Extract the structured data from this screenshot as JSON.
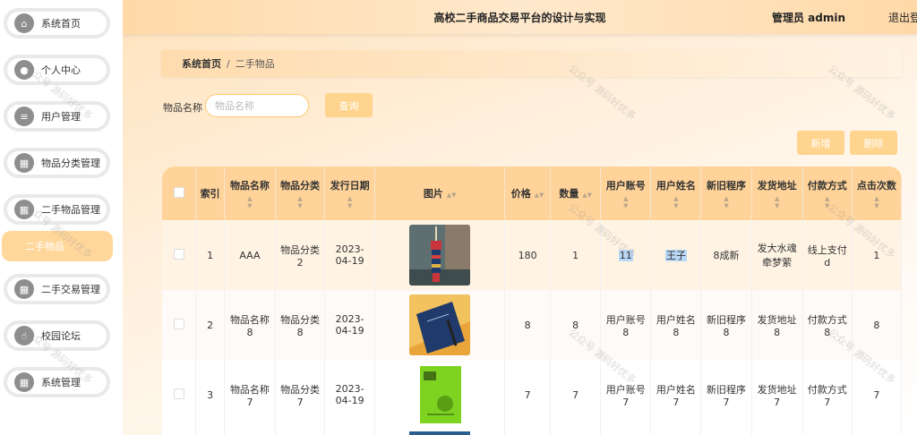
{
  "sidebar": {
    "items": [
      {
        "label": "系统首页",
        "icon": "home-icon",
        "glyph": "⌂"
      },
      {
        "label": "个人中心",
        "icon": "user-icon",
        "glyph": "●"
      },
      {
        "label": "用户管理",
        "icon": "sliders-icon",
        "glyph": "≡"
      },
      {
        "label": "物品分类管理",
        "icon": "grid-icon",
        "glyph": "▦"
      },
      {
        "label": "二手物品管理",
        "icon": "grid-icon",
        "glyph": "▦"
      },
      {
        "label": "二手交易管理",
        "icon": "grid-icon",
        "glyph": "▦"
      },
      {
        "label": "校园论坛",
        "icon": "thumbs-up-icon",
        "glyph": "☝"
      },
      {
        "label": "系统管理",
        "icon": "grid-icon",
        "glyph": "▦"
      }
    ],
    "submenu_active": "二手物品"
  },
  "header": {
    "title": "高校二手商品交易平台的设计与实现",
    "admin": "管理员 admin",
    "logout": "退出登"
  },
  "breadcrumb": {
    "home": "系统首页",
    "separator": "/",
    "current": "二手物品"
  },
  "search": {
    "label": "物品名称",
    "placeholder": "物品名称",
    "value": "",
    "query_button": "查询"
  },
  "actions": {
    "add": "新增",
    "delete": "删除"
  },
  "table": {
    "columns": [
      "",
      "索引",
      "物品名称",
      "物品分类",
      "发行日期",
      "图片",
      "价格",
      "数量",
      "用户账号",
      "用户姓名",
      "新旧程序",
      "发货地址",
      "付款方式",
      "点击次数"
    ],
    "rows": [
      {
        "index": "1",
        "name": "AAA",
        "category": "物品分类2",
        "date": "2023-04-19",
        "image": "keychain-photo",
        "price": "180",
        "qty": "1",
        "account": "11",
        "username": "王子",
        "condition": "8成新",
        "address": "发大水魂牵梦萦",
        "payment": "线上支付d",
        "clicks": "1"
      },
      {
        "index": "2",
        "name": "物品名称8",
        "category": "物品分类8",
        "date": "2023-04-19",
        "image": "notebook-photo",
        "price": "8",
        "qty": "8",
        "account": "用户账号8",
        "username": "用户姓名8",
        "condition": "新旧程序8",
        "address": "发货地址8",
        "payment": "付款方式8",
        "clicks": "8"
      },
      {
        "index": "3",
        "name": "物品名称7",
        "category": "物品分类7",
        "date": "2023-04-19",
        "image": "book-cover-photo",
        "price": "7",
        "qty": "7",
        "account": "用户账号7",
        "username": "用户姓名7",
        "condition": "新旧程序7",
        "address": "发货地址7",
        "payment": "付款方式7",
        "clicks": "7"
      }
    ]
  },
  "watermark": "公众号 源码好优多",
  "colors": {
    "accent": "#ffd48f",
    "header": "#ffd399",
    "highlight": "#b9d7f6"
  }
}
